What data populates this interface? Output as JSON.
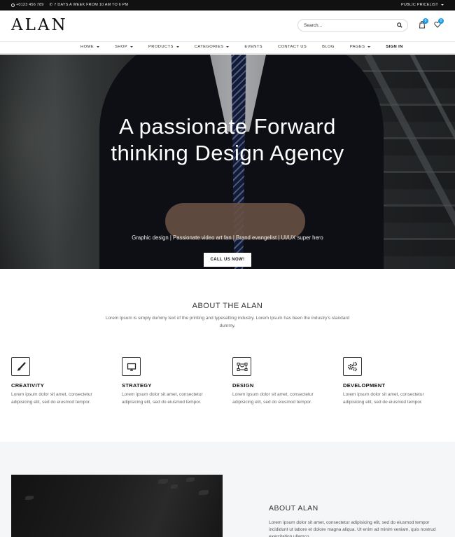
{
  "topbar": {
    "phone": "+0123 456 789",
    "hours": "7 DAYS A WEEK FROM 10 AM TO 6 PM",
    "pricelist": "PUBLIC PRICELIST"
  },
  "header": {
    "logo": "ALAN",
    "search_placeholder": "Search...",
    "cart_count": "0",
    "wishlist_count": "0"
  },
  "nav": {
    "items": [
      {
        "label": "HOME",
        "dropdown": true
      },
      {
        "label": "SHOP",
        "dropdown": true
      },
      {
        "label": "PRODUCTS",
        "dropdown": true
      },
      {
        "label": "CATEGORIES",
        "dropdown": true
      },
      {
        "label": "EVENTS",
        "dropdown": false
      },
      {
        "label": "CONTACT US",
        "dropdown": false
      },
      {
        "label": "BLOG",
        "dropdown": false
      },
      {
        "label": "PAGES",
        "dropdown": true
      },
      {
        "label": "SIGN IN",
        "dropdown": false
      }
    ]
  },
  "hero": {
    "title_line1": "A passionate Forward",
    "title_line2": "thinking Design Agency",
    "subtitle": "Graphic design | Passionate video art fan | Brand evangelist | UI/UX super hero",
    "cta": "CALL US NOW!"
  },
  "about": {
    "title": "ABOUT THE ALAN",
    "text": "Lorem Ipsum is simply dummy text of the printing and typesetting industry. Lorem Ipsum has been the industry's standard dummy."
  },
  "features": [
    {
      "icon": "brush-icon",
      "title": "CREATIVITY",
      "text": "Lorem ipsum dolor sit amet, consectetur adipisicing elit, sed do eiusmod tempor."
    },
    {
      "icon": "monitor-icon",
      "title": "STRATEGY",
      "text": "Lorem ipsum dolor sit amet, consectetur adipisicing elit, sed do eiusmod tempor."
    },
    {
      "icon": "vector-design-icon",
      "title": "DESIGN",
      "text": "Lorem ipsum dolor sit amet, consectetur adipisicing elit, sed do eiusmod tempor."
    },
    {
      "icon": "gears-icon",
      "title": "DEVELOPMENT",
      "text": "Lorem ipsum dolor sit amet, consectetur adipisicing elit, sed do eiusmod tempor."
    }
  ],
  "about2": {
    "title": "ABOUT ALAN",
    "text": "Lorem ipsum dolor sit amet, consectetur adipisicing elit, sed do eiusmod tempor incididunt ut labore et dolore magna aliqua. Ut enim ad minim veniam, quis nostrud exercitation ullamco."
  },
  "colors": {
    "topbar_bg": "#111111",
    "badge": "#1e9ce3",
    "section_bg": "#f5f6f8"
  }
}
